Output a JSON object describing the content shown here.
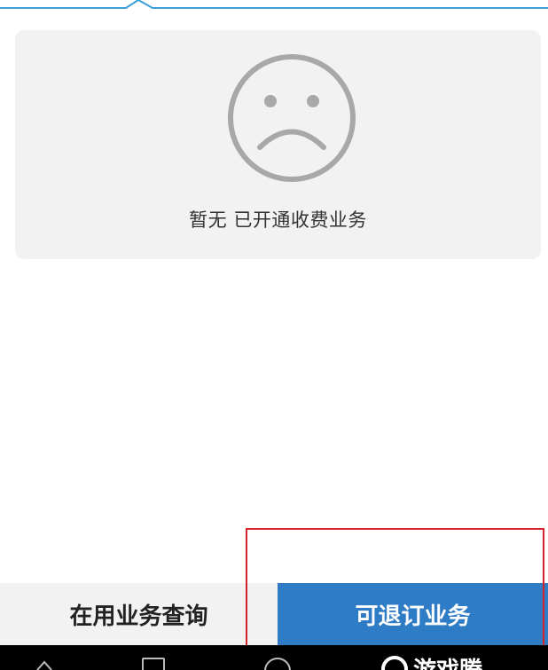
{
  "top_indicator": {
    "color": "#3a9fd8"
  },
  "empty_state": {
    "icon": "sad-face-icon",
    "message": "暂无 已开通收费业务"
  },
  "bottom_bar": {
    "in_use_label": "在用业务查询",
    "unsubscribe_label": "可退订业务",
    "active_color": "#2f7cc6"
  },
  "highlight": {
    "color": "#d2232a"
  },
  "nav_bar": {
    "icons": [
      "back-icon",
      "recent-apps-icon",
      "home-icon"
    ]
  },
  "watermark": {
    "text": "游戏腾"
  }
}
